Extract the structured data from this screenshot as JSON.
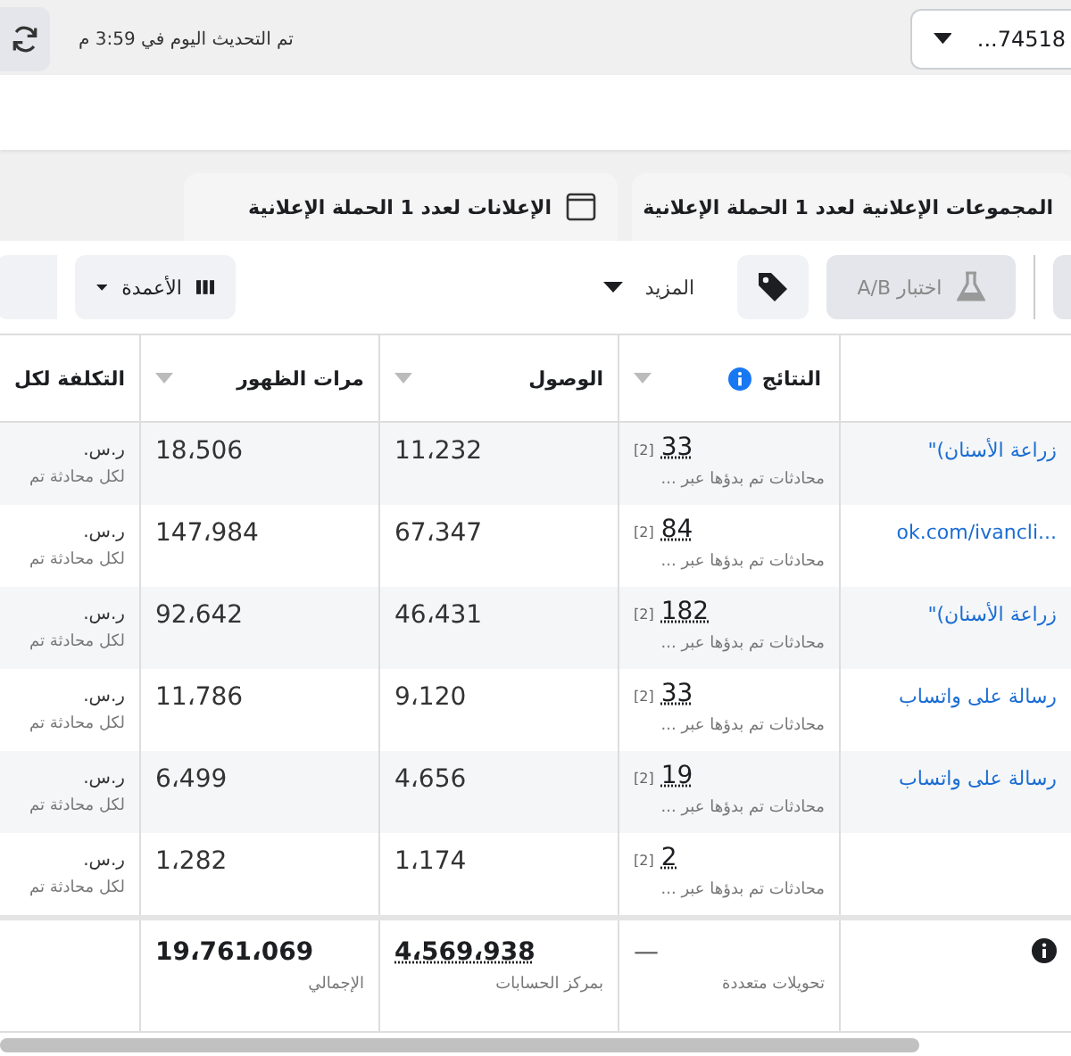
{
  "top_bar": {
    "account_dropdown": "...74518",
    "updated_text": "تم التحديث اليوم في 3:59 م"
  },
  "tabs": [
    {
      "label": "المجموعات الإعلانية لعدد **1** الحملة الإعلانية",
      "kind": "plain"
    },
    {
      "label": "الإعلانات لعدد **1** الحملة الإعلانية",
      "kind": "window"
    }
  ],
  "toolbar": {
    "ab_test": {
      "label": "اختبار A/B",
      "disabled": true
    },
    "more": "المزيد",
    "columns": "الأعمدة"
  },
  "table": {
    "columns": [
      "النتائج",
      "الوصول",
      "مرات الظهور",
      "التكلفة لكل"
    ],
    "rows": [
      {
        "name": "زراعة الأسنان)\"",
        "results": "33",
        "results_note": "[2]",
        "results_sub": "محادثات تم بدؤها عبر ...",
        "reach": "11،232",
        "impressions": "18،506",
        "cost": "ر.س.",
        "cost_sub": "لكل محادثة تم"
      },
      {
        "name": "...ok.com/ivancli",
        "results": "84",
        "results_note": "[2]",
        "results_sub": "محادثات تم بدؤها عبر ...",
        "reach": "67،347",
        "impressions": "147،984",
        "cost": "ر.س.",
        "cost_sub": "لكل محادثة تم"
      },
      {
        "name": "زراعة الأسنان)\"",
        "results": "182",
        "results_note": "[2]",
        "results_sub": "محادثات تم بدؤها عبر ...",
        "reach": "46،431",
        "impressions": "92،642",
        "cost": "ر.س.",
        "cost_sub": "لكل محادثة تم"
      },
      {
        "name": "رسالة على واتساب",
        "results": "33",
        "results_note": "[2]",
        "results_sub": "محادثات تم بدؤها عبر ...",
        "reach": "9،120",
        "impressions": "11،786",
        "cost": "ر.س.",
        "cost_sub": "لكل محادثة تم"
      },
      {
        "name": "رسالة على واتساب",
        "results": "19",
        "results_note": "[2]",
        "results_sub": "محادثات تم بدؤها عبر ...",
        "reach": "4،656",
        "impressions": "6،499",
        "cost": "ر.س.",
        "cost_sub": "لكل محادثة تم"
      },
      {
        "results": "2",
        "results_note": "[2]",
        "results_sub": "محادثات تم بدؤها عبر ...",
        "reach": "1،174",
        "impressions": "1،282",
        "cost": "ر.س.",
        "cost_sub": "لكل محادثة تم"
      }
    ],
    "footer": {
      "results": "—",
      "results_sub": "تحويلات متعددة",
      "reach": "4،569،938",
      "reach_sub": "بمركز الحسابات",
      "impressions": "19،761،069",
      "impressions_sub": "الإجمالي"
    }
  }
}
